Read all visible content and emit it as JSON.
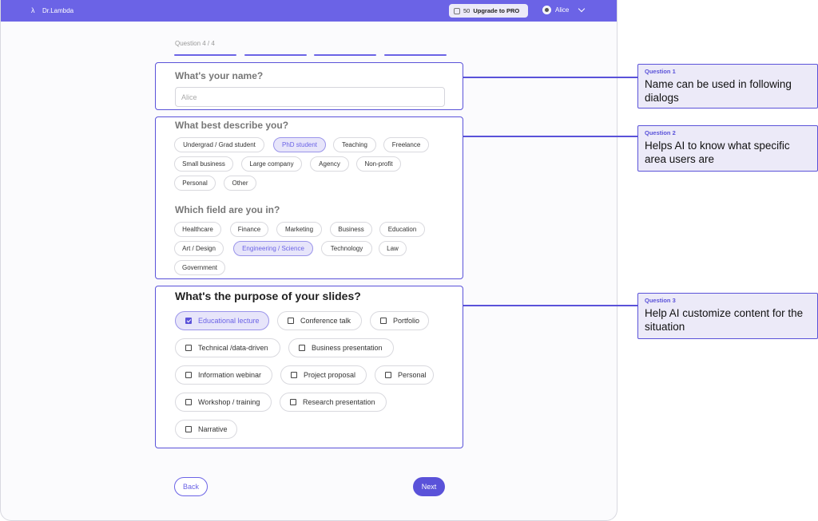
{
  "topbar": {
    "logo_text": "Dr.Lambda",
    "credits": "50",
    "upgrade_label": "Upgrade to PRO",
    "user_name": "Alice"
  },
  "progress": {
    "label": "Question 4 / 4",
    "steps_total": 4,
    "steps_done": 4
  },
  "q_name": {
    "title": "What's your name?",
    "placeholder": "Alice"
  },
  "q_describe": {
    "title": "What best describe you?",
    "options": [
      "Undergrad / Grad student",
      "PhD student",
      "Teaching",
      "Freelance",
      "Small business",
      "Large company",
      "Agency",
      "Non-profit",
      "Personal",
      "Other"
    ],
    "selected": "PhD student"
  },
  "q_field": {
    "title": "Which field are you in?",
    "options": [
      "Healthcare",
      "Finance",
      "Marketing",
      "Business",
      "Education",
      "Art / Design",
      "Engineering / Science",
      "Technology",
      "Law",
      "Government"
    ],
    "selected": "Engineering / Science"
  },
  "q_purpose": {
    "title": "What's the purpose of your slides?",
    "options": [
      "Educational lecture",
      "Conference talk",
      "Portfolio",
      "Technical /data-driven",
      "Business presentation",
      "Information webinar",
      "Project proposal",
      "Personal",
      "Workshop / training",
      "Research presentation",
      "Narrative"
    ],
    "selected": "Educational lecture"
  },
  "nav": {
    "back_label": "Back",
    "next_label": "Next"
  },
  "notes": [
    {
      "tag": "Question 1",
      "text": "Name can be used in following dialogs"
    },
    {
      "tag": "Question 2",
      "text": "Helps AI to know what specific area users are"
    },
    {
      "tag": "Question 3",
      "text": "Help AI customize content for the situation"
    }
  ],
  "colors": {
    "accent": "#6b63e6",
    "accent_dark": "#5a52d9",
    "selected_bg": "#e7e5fa",
    "note_bg": "#eceaf8"
  }
}
